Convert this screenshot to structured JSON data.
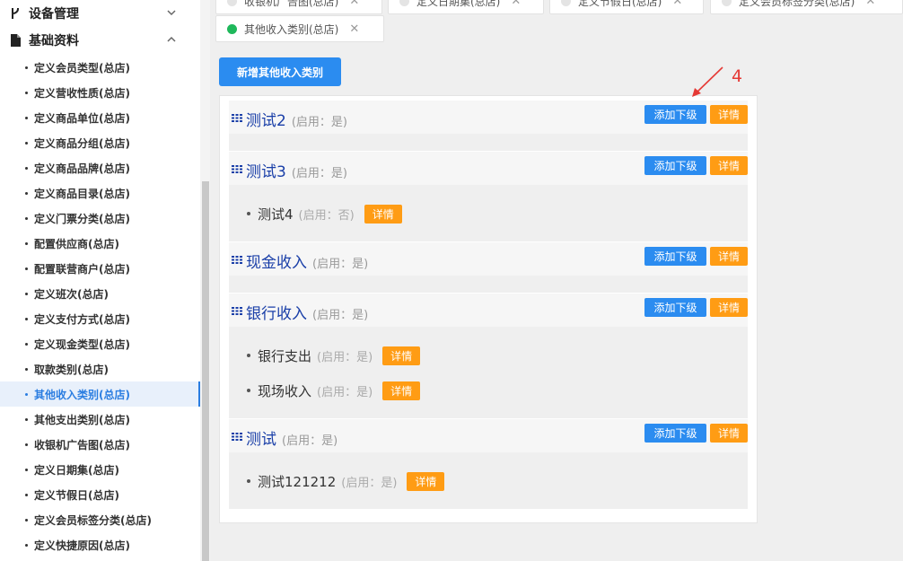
{
  "sidebar": {
    "groups": [
      {
        "label": "设备管理",
        "icon": "device-icon"
      },
      {
        "label": "基础资料",
        "icon": "document-icon"
      }
    ],
    "items": [
      {
        "label": "定义会员类型(总店)"
      },
      {
        "label": "定义营收性质(总店)"
      },
      {
        "label": "定义商品单位(总店)"
      },
      {
        "label": "定义商品分组(总店)"
      },
      {
        "label": "定义商品品牌(总店)"
      },
      {
        "label": "定义商品目录(总店)"
      },
      {
        "label": "定义门票分类(总店)"
      },
      {
        "label": "配置供应商(总店)"
      },
      {
        "label": "配置联营商户(总店)"
      },
      {
        "label": "定义班次(总店)"
      },
      {
        "label": "定义支付方式(总店)"
      },
      {
        "label": "定义现金类型(总店)"
      },
      {
        "label": "取款类别(总店)"
      },
      {
        "label": "其他收入类别(总店)",
        "active": true
      },
      {
        "label": "其他支出类别(总店)"
      },
      {
        "label": "收银机广告图(总店)"
      },
      {
        "label": "定义日期集(总店)"
      },
      {
        "label": "定义节假日(总店)"
      },
      {
        "label": "定义会员标签分类(总店)"
      },
      {
        "label": "定义快捷原因(总店)"
      }
    ]
  },
  "tabs": [
    {
      "label": "收银机广告图(总店)"
    },
    {
      "label": "定义日期集(总店)"
    },
    {
      "label": "定义节假日(总店)"
    },
    {
      "label": "定义会员标签分类(总店)"
    },
    {
      "label": "其他收入类别(总店)",
      "active": true
    }
  ],
  "toolbar": {
    "add_label": "新增其他收入类别"
  },
  "buttons": {
    "add_child": "添加下级",
    "detail": "详情"
  },
  "tree": [
    {
      "title": "测试2",
      "status": "(启用：是)",
      "children": []
    },
    {
      "title": "测试3",
      "status": "(启用：是)",
      "children": [
        {
          "title": "测试4",
          "status": "(启用：否)"
        }
      ]
    },
    {
      "title": "现金收入",
      "status": "(启用：是)",
      "children": []
    },
    {
      "title": "银行收入",
      "status": "(启用：是)",
      "children": [
        {
          "title": "银行支出",
          "status": "(启用：是)"
        },
        {
          "title": "现场收入",
          "status": "(启用：是)"
        }
      ]
    },
    {
      "title": "测试",
      "status": "(启用：是)",
      "children": [
        {
          "title": "测试121212",
          "status": "(启用：是)"
        }
      ]
    }
  ],
  "annotation": {
    "label": "4"
  },
  "colors": {
    "primary": "#2b8cf0",
    "detail": "#ff9c14",
    "title": "#1a3fa8",
    "active_tab_dot": "#1fb85b",
    "annotation": "#e53935"
  }
}
